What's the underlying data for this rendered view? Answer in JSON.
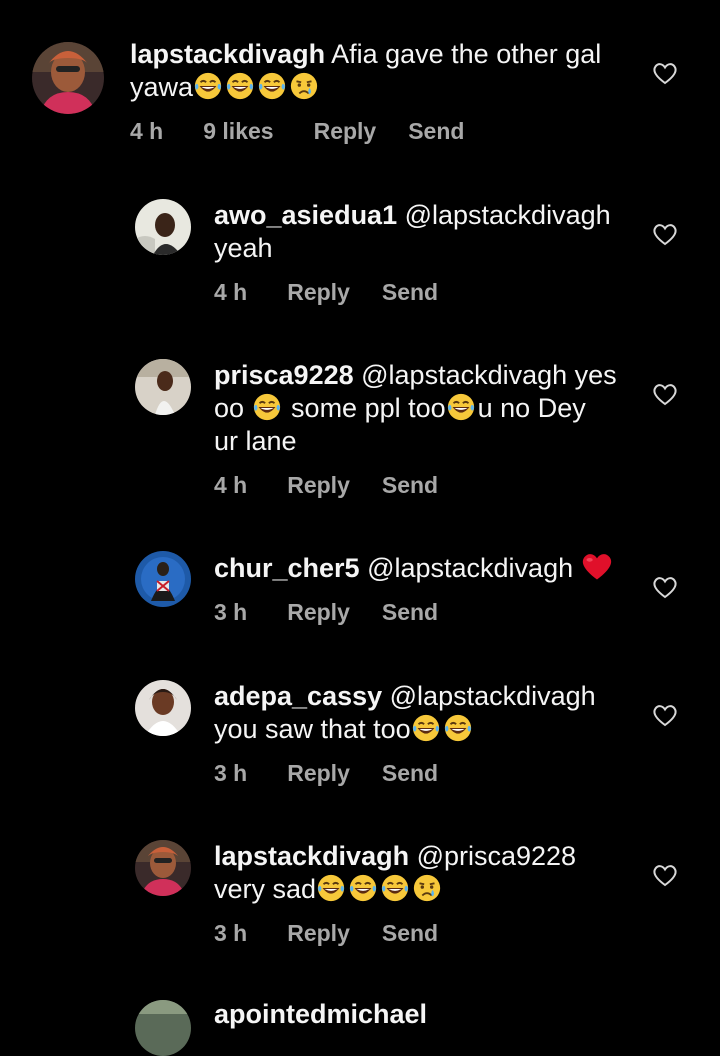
{
  "comments": [
    {
      "username": "lapstackdivagh",
      "text_a": " Afia gave the other gal",
      "text_b": "yawa",
      "emojis": [
        "grin-tears-emoji",
        "grin-tears-emoji",
        "grin-tears-emoji",
        "crying-emoji"
      ],
      "time": "4 h",
      "likes": "9 likes",
      "reply": "Reply",
      "send": "Send"
    },
    {
      "username": "awo_asiedua1",
      "text_a": " @lapstackdivagh",
      "text_b": "yeah",
      "time": "4 h",
      "reply": "Reply",
      "send": "Send"
    },
    {
      "username": "prisca9228",
      "text_a": " @lapstackdivagh yes",
      "text_b": "oo ",
      "text_c": " some ppl too",
      "text_d": "u no Dey",
      "text_e": "ur lane",
      "time": "4 h",
      "reply": "Reply",
      "send": "Send"
    },
    {
      "username": "chur_cher5",
      "text_a": " @lapstackdivagh ",
      "emojis": [
        "red-heart-emoji"
      ],
      "time": "3 h",
      "reply": "Reply",
      "send": "Send"
    },
    {
      "username": "adepa_cassy",
      "text_a": " @lapstackdivagh",
      "text_b": "you saw that too",
      "emojis": [
        "grin-tears-emoji",
        "grin-tears-emoji"
      ],
      "time": "3 h",
      "reply": "Reply",
      "send": "Send"
    },
    {
      "username": "lapstackdivagh",
      "text_a": " @prisca9228",
      "text_b": "very sad",
      "emojis": [
        "grin-tears-emoji",
        "grin-tears-emoji",
        "grin-tears-emoji",
        "crying-emoji"
      ],
      "time": "3 h",
      "reply": "Reply",
      "send": "Send"
    }
  ],
  "partial_username": "apointedmichael",
  "colors": {
    "background": "#000000",
    "text": "#f5f5f5",
    "meta": "#a8a8a8",
    "heart_outline": "#a8a8a8",
    "red_heart": "#e0102a",
    "emoji_yellow": "#f7c83a"
  }
}
